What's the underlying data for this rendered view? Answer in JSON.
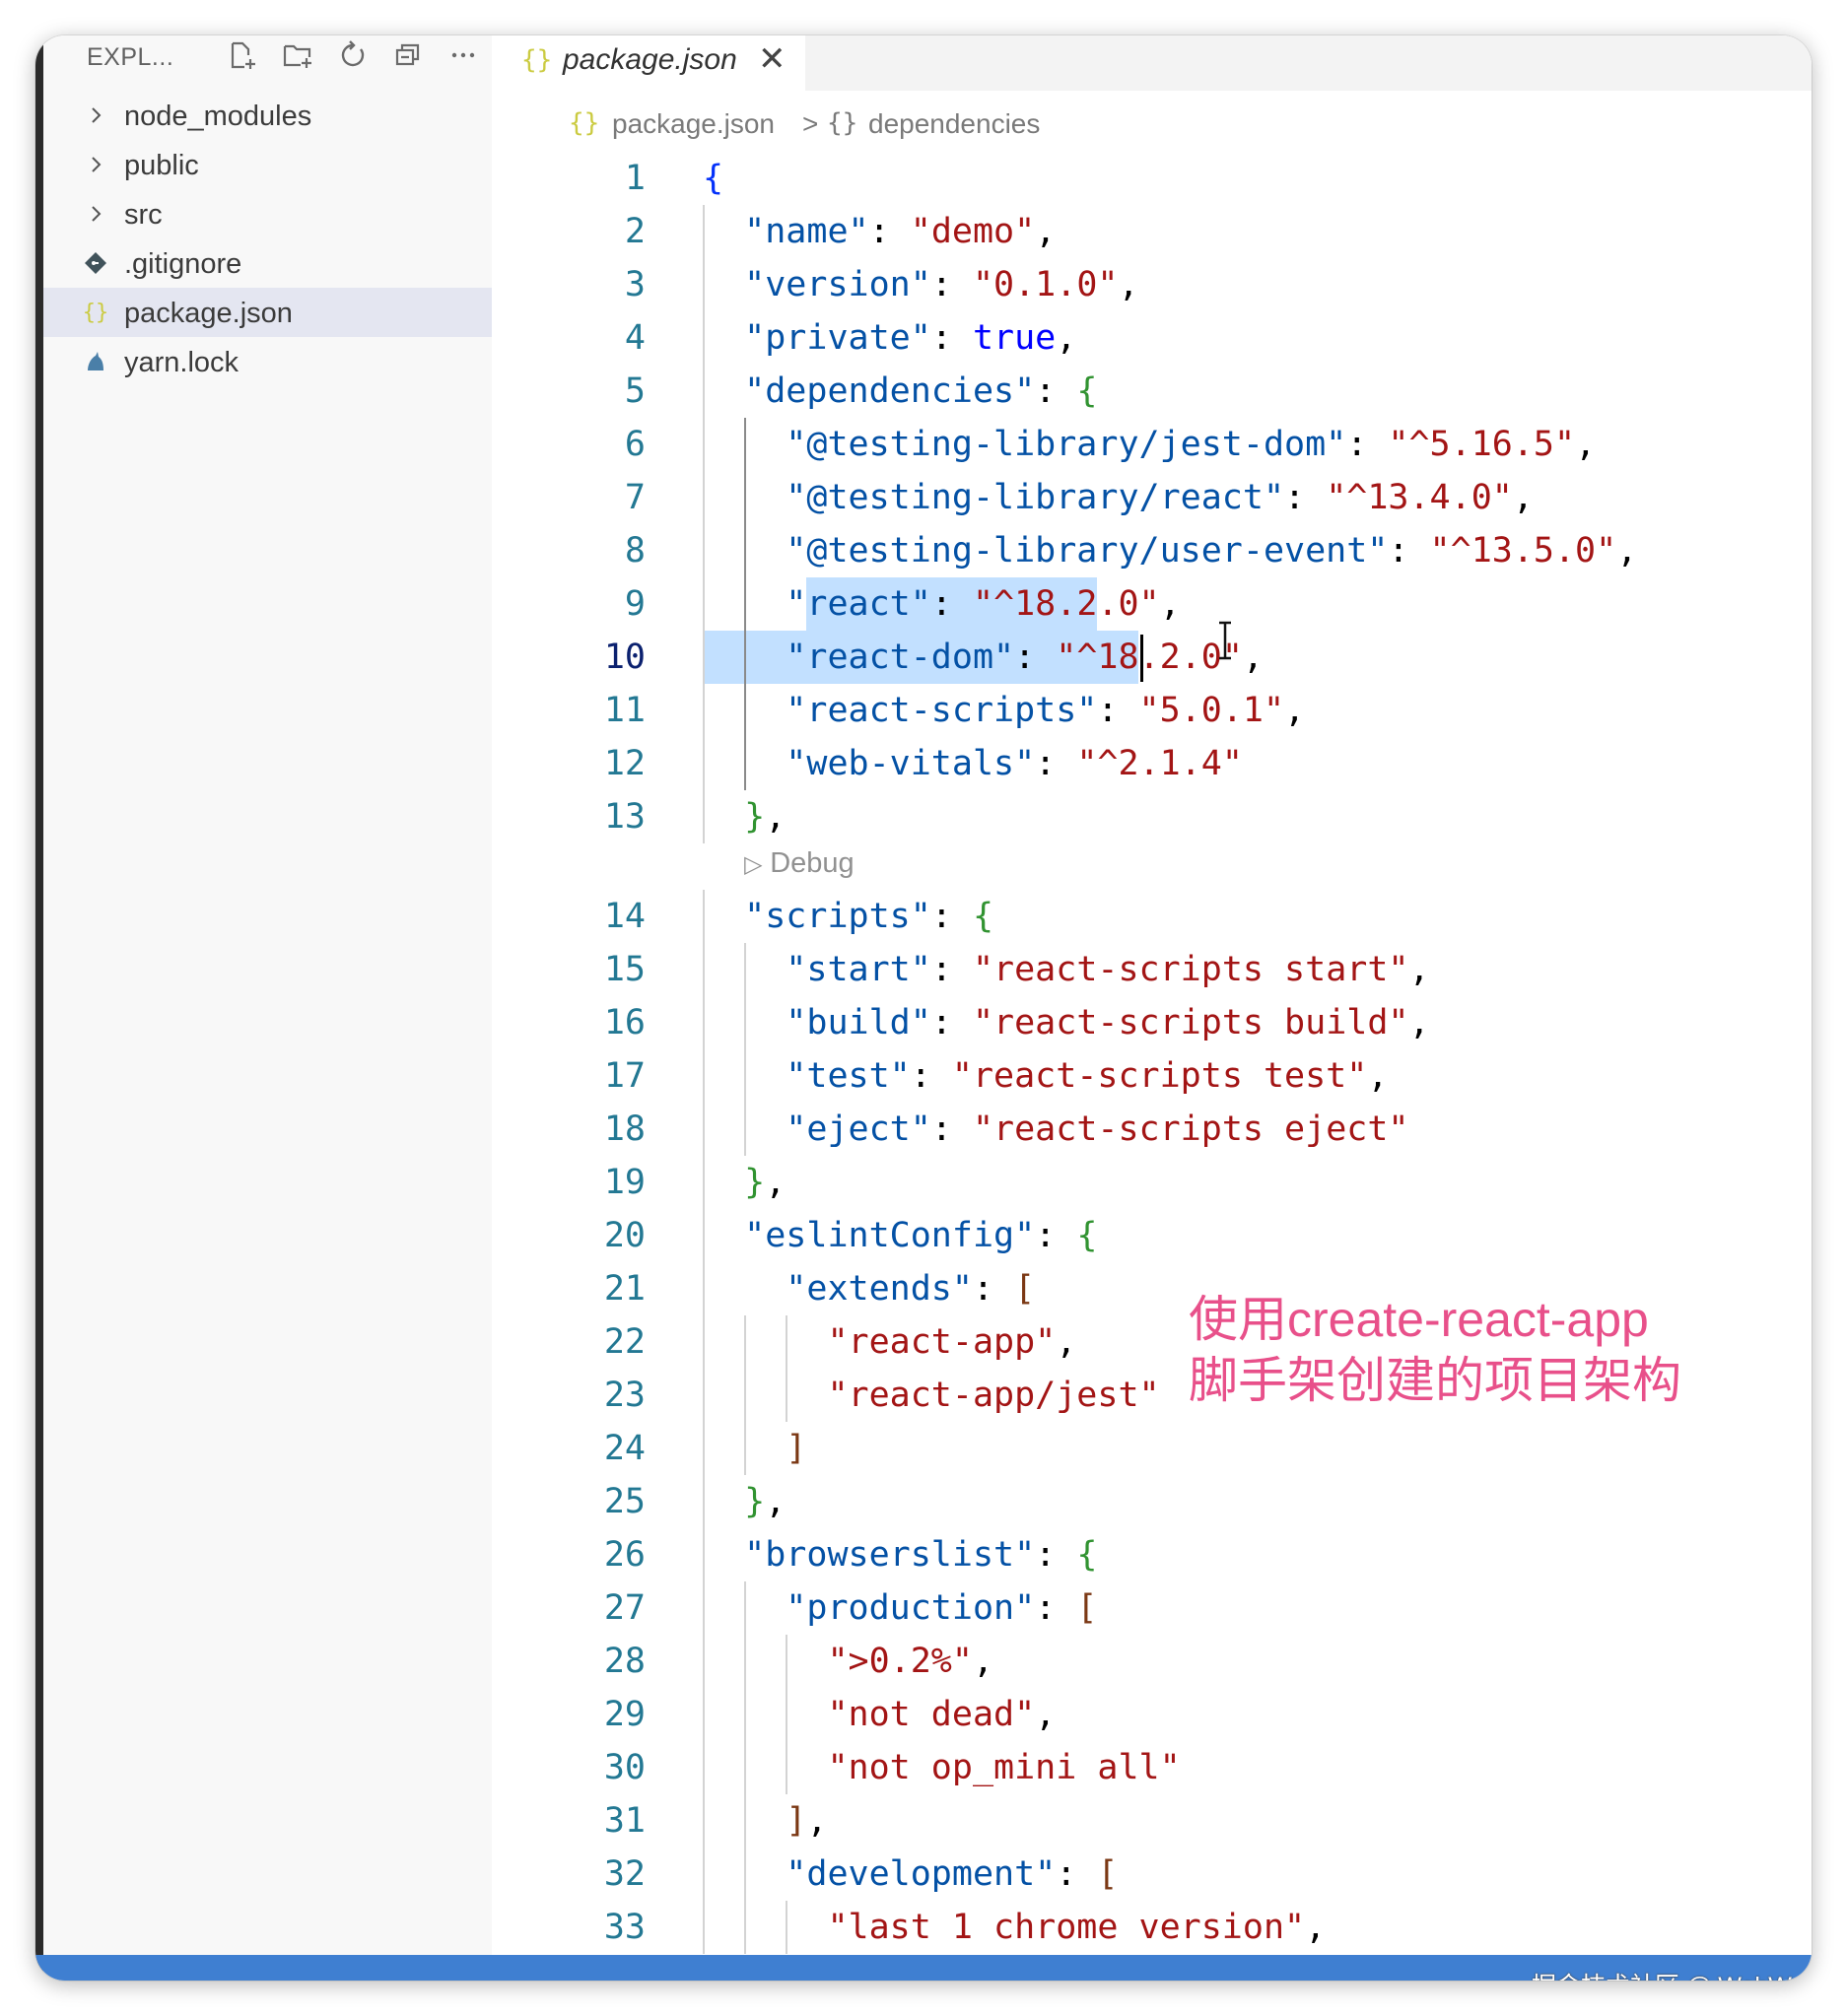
{
  "sidebar": {
    "title": "EXPL...",
    "actions": [
      {
        "name": "new-file-icon"
      },
      {
        "name": "new-folder-icon"
      },
      {
        "name": "refresh-icon"
      },
      {
        "name": "collapse-all-icon"
      },
      {
        "name": "more-actions-icon"
      }
    ],
    "items": [
      {
        "label": "node_modules",
        "icon": "chevron-right-icon",
        "type": "folder"
      },
      {
        "label": "public",
        "icon": "chevron-right-icon",
        "type": "folder"
      },
      {
        "label": "src",
        "icon": "chevron-right-icon",
        "type": "folder"
      },
      {
        "label": ".gitignore",
        "icon": "git-icon",
        "type": "file"
      },
      {
        "label": "package.json",
        "icon": "json-icon",
        "type": "file",
        "selected": true
      },
      {
        "label": "yarn.lock",
        "icon": "yarn-icon",
        "type": "file"
      }
    ]
  },
  "editor": {
    "tab": {
      "label": "package.json",
      "icon_text": "{}",
      "close": "✕"
    },
    "breadcrumb": {
      "icon1": "{}",
      "file": "package.json",
      "sep": ">",
      "icon2": "{}",
      "symbol": "dependencies"
    },
    "codelens": "Debug",
    "active_line": 10,
    "lines": [
      {
        "n": "1",
        "tokens": [
          [
            "{",
            "b1"
          ]
        ]
      },
      {
        "n": "2",
        "tokens": [
          [
            "  ",
            "p"
          ],
          [
            "\"name\"",
            "k"
          ],
          [
            ": ",
            "p"
          ],
          [
            "\"demo\"",
            "s"
          ],
          [
            ",",
            "p"
          ]
        ]
      },
      {
        "n": "3",
        "tokens": [
          [
            "  ",
            "p"
          ],
          [
            "\"version\"",
            "k"
          ],
          [
            ": ",
            "p"
          ],
          [
            "\"0.1.0\"",
            "s"
          ],
          [
            ",",
            "p"
          ]
        ]
      },
      {
        "n": "4",
        "tokens": [
          [
            "  ",
            "p"
          ],
          [
            "\"private\"",
            "k"
          ],
          [
            ": ",
            "p"
          ],
          [
            "true",
            "kw"
          ],
          [
            ",",
            "p"
          ]
        ]
      },
      {
        "n": "5",
        "tokens": [
          [
            "  ",
            "p"
          ],
          [
            "\"dependencies\"",
            "k"
          ],
          [
            ": ",
            "p"
          ],
          [
            "{",
            "b2"
          ]
        ]
      },
      {
        "n": "6",
        "tokens": [
          [
            "    ",
            "p"
          ],
          [
            "\"@testing-library/jest-dom\"",
            "k"
          ],
          [
            ": ",
            "p"
          ],
          [
            "\"^5.16.5\"",
            "s"
          ],
          [
            ",",
            "p"
          ]
        ]
      },
      {
        "n": "7",
        "tokens": [
          [
            "    ",
            "p"
          ],
          [
            "\"@testing-library/react\"",
            "k"
          ],
          [
            ": ",
            "p"
          ],
          [
            "\"^13.4.0\"",
            "s"
          ],
          [
            ",",
            "p"
          ]
        ]
      },
      {
        "n": "8",
        "tokens": [
          [
            "    ",
            "p"
          ],
          [
            "\"@testing-library/user-event\"",
            "k"
          ],
          [
            ": ",
            "p"
          ],
          [
            "\"^13.5.0\"",
            "s"
          ],
          [
            ",",
            "p"
          ]
        ]
      },
      {
        "n": "9",
        "tokens": [
          [
            "    ",
            "p"
          ],
          [
            "\"react\"",
            "k"
          ],
          [
            ": ",
            "p"
          ],
          [
            "\"^18.2.0\"",
            "s"
          ],
          [
            ",",
            "p"
          ]
        ]
      },
      {
        "n": "10",
        "tokens": [
          [
            "    ",
            "p"
          ],
          [
            "\"react-dom\"",
            "k"
          ],
          [
            ": ",
            "p"
          ],
          [
            "\"^18.2.0\"",
            "s"
          ],
          [
            ",",
            "p"
          ]
        ]
      },
      {
        "n": "11",
        "tokens": [
          [
            "    ",
            "p"
          ],
          [
            "\"react-scripts\"",
            "k"
          ],
          [
            ": ",
            "p"
          ],
          [
            "\"5.0.1\"",
            "s"
          ],
          [
            ",",
            "p"
          ]
        ]
      },
      {
        "n": "12",
        "tokens": [
          [
            "    ",
            "p"
          ],
          [
            "\"web-vitals\"",
            "k"
          ],
          [
            ": ",
            "p"
          ],
          [
            "\"^2.1.4\"",
            "s"
          ]
        ]
      },
      {
        "n": "13",
        "tokens": [
          [
            "  ",
            "p"
          ],
          [
            "}",
            "b2"
          ],
          [
            ",",
            "p"
          ]
        ]
      },
      {
        "n": "14",
        "tokens": [
          [
            "  ",
            "p"
          ],
          [
            "\"scripts\"",
            "k"
          ],
          [
            ": ",
            "p"
          ],
          [
            "{",
            "b2"
          ]
        ]
      },
      {
        "n": "15",
        "tokens": [
          [
            "    ",
            "p"
          ],
          [
            "\"start\"",
            "k"
          ],
          [
            ": ",
            "p"
          ],
          [
            "\"react-scripts start\"",
            "s"
          ],
          [
            ",",
            "p"
          ]
        ]
      },
      {
        "n": "16",
        "tokens": [
          [
            "    ",
            "p"
          ],
          [
            "\"build\"",
            "k"
          ],
          [
            ": ",
            "p"
          ],
          [
            "\"react-scripts build\"",
            "s"
          ],
          [
            ",",
            "p"
          ]
        ]
      },
      {
        "n": "17",
        "tokens": [
          [
            "    ",
            "p"
          ],
          [
            "\"test\"",
            "k"
          ],
          [
            ": ",
            "p"
          ],
          [
            "\"react-scripts test\"",
            "s"
          ],
          [
            ",",
            "p"
          ]
        ]
      },
      {
        "n": "18",
        "tokens": [
          [
            "    ",
            "p"
          ],
          [
            "\"eject\"",
            "k"
          ],
          [
            ": ",
            "p"
          ],
          [
            "\"react-scripts eject\"",
            "s"
          ]
        ]
      },
      {
        "n": "19",
        "tokens": [
          [
            "  ",
            "p"
          ],
          [
            "}",
            "b2"
          ],
          [
            ",",
            "p"
          ]
        ]
      },
      {
        "n": "20",
        "tokens": [
          [
            "  ",
            "p"
          ],
          [
            "\"eslintConfig\"",
            "k"
          ],
          [
            ": ",
            "p"
          ],
          [
            "{",
            "b2"
          ]
        ]
      },
      {
        "n": "21",
        "tokens": [
          [
            "    ",
            "p"
          ],
          [
            "\"extends\"",
            "k"
          ],
          [
            ": ",
            "p"
          ],
          [
            "[",
            "b3"
          ]
        ]
      },
      {
        "n": "22",
        "tokens": [
          [
            "      ",
            "p"
          ],
          [
            "\"react-app\"",
            "s"
          ],
          [
            ",",
            "p"
          ]
        ]
      },
      {
        "n": "23",
        "tokens": [
          [
            "      ",
            "p"
          ],
          [
            "\"react-app/jest\"",
            "s"
          ]
        ]
      },
      {
        "n": "24",
        "tokens": [
          [
            "    ",
            "p"
          ],
          [
            "]",
            "b3"
          ]
        ]
      },
      {
        "n": "25",
        "tokens": [
          [
            "  ",
            "p"
          ],
          [
            "}",
            "b2"
          ],
          [
            ",",
            "p"
          ]
        ]
      },
      {
        "n": "26",
        "tokens": [
          [
            "  ",
            "p"
          ],
          [
            "\"browserslist\"",
            "k"
          ],
          [
            ": ",
            "p"
          ],
          [
            "{",
            "b2"
          ]
        ]
      },
      {
        "n": "27",
        "tokens": [
          [
            "    ",
            "p"
          ],
          [
            "\"production\"",
            "k"
          ],
          [
            ": ",
            "p"
          ],
          [
            "[",
            "b3"
          ]
        ]
      },
      {
        "n": "28",
        "tokens": [
          [
            "      ",
            "p"
          ],
          [
            "\">0.2%\"",
            "s"
          ],
          [
            ",",
            "p"
          ]
        ]
      },
      {
        "n": "29",
        "tokens": [
          [
            "      ",
            "p"
          ],
          [
            "\"not dead\"",
            "s"
          ],
          [
            ",",
            "p"
          ]
        ]
      },
      {
        "n": "30",
        "tokens": [
          [
            "      ",
            "p"
          ],
          [
            "\"not op_mini all\"",
            "s"
          ]
        ]
      },
      {
        "n": "31",
        "tokens": [
          [
            "    ",
            "p"
          ],
          [
            "]",
            "b3"
          ],
          [
            ",",
            "p"
          ]
        ]
      },
      {
        "n": "32",
        "tokens": [
          [
            "    ",
            "p"
          ],
          [
            "\"development\"",
            "k"
          ],
          [
            ": ",
            "p"
          ],
          [
            "[",
            "b3"
          ]
        ]
      },
      {
        "n": "33",
        "tokens": [
          [
            "      ",
            "p"
          ],
          [
            "\"last 1 chrome version\"",
            "s"
          ],
          [
            ",",
            "p"
          ]
        ]
      }
    ]
  },
  "overlay_note": {
    "line1": "使用create-react-app",
    "line2": "脚手架创建的项目架构"
  },
  "watermark": "掘金技术社区 @ WebWong",
  "colors": {
    "key": "#0451a5",
    "string": "#a31515",
    "keyword": "#0000ff",
    "selection": "#add6ff",
    "line_number": "#237893",
    "status_bar": "#3f7fd1",
    "overlay_text": "#e8508a"
  }
}
